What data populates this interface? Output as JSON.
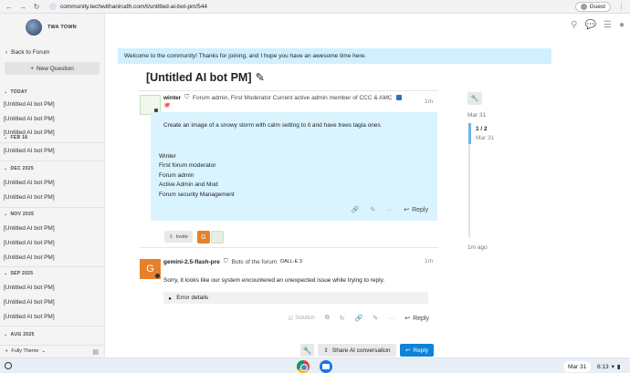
{
  "browser": {
    "url": "community.techwithanirudh.com/t/untitled-ai-bot-pm/544",
    "guest_label": "Guest"
  },
  "site": {
    "name": "TWA TOWN"
  },
  "sidebar": {
    "back_label": "Back to Forum",
    "new_question_label": "New Question",
    "sections": [
      {
        "label": "TODAY",
        "items": [
          "[Untitled AI bot PM]",
          "[Untitled AI bot PM]",
          "[Untitled AI bot PM]"
        ]
      },
      {
        "label": "FEB 18",
        "items": [
          "[Untitled AI bot PM]"
        ]
      },
      {
        "label": "DEC 2025",
        "items": [
          "[Untitled AI bot PM]",
          "[Untitled AI bot PM]"
        ]
      },
      {
        "label": "NOV 2025",
        "items": [
          "[Untitled AI bot PM]",
          "[Untitled AI bot PM]",
          "[Untitled AI bot PM]"
        ]
      },
      {
        "label": "SEP 2025",
        "items": [
          "[Untitled AI bot PM]",
          "[Untitled AI bot PM]",
          "[Untitled AI bot PM]"
        ]
      },
      {
        "label": "AUG 2025",
        "items": []
      }
    ],
    "theme_label": "Fully Theme"
  },
  "banner": "Welcome to the community! Thanks for joining, and I hope you have an awesome time here.",
  "topic": {
    "title": "[Untitled AI bot PM]"
  },
  "posts": [
    {
      "username": "winter",
      "title": "Forum admin, First Moderator Current active admin member of CCC & AMC",
      "emoji": "🐙",
      "time": "1m",
      "question": "Create an image of a snowy storm with calm setting to it and have trees tagia ones",
      "signature": [
        "Winter",
        "First forum moderator",
        "Forum admin",
        "Active Admin and Mod",
        "Forum security Management"
      ],
      "reply_label": "Reply"
    },
    {
      "username": "gemini-2.5-flash-pre",
      "title": "Bots of the forum",
      "tag": "DALL-E 3",
      "time": "1m",
      "message": "Sorry, it looks like our system encountered an unexpected issue while trying to reply.",
      "details_label": "Error details",
      "solution_label": "Solution",
      "reply_label": "Reply"
    }
  ],
  "invite_label": "Invite",
  "participant_avatar_letter": "G",
  "bottom": {
    "share_label": "Share AI conversation",
    "reply_label": "Reply"
  },
  "timeline": {
    "start": "Mar 31",
    "count": "1 / 2",
    "current_date": "Mar 31",
    "end": "1m ago"
  },
  "taskbar": {
    "date": "Mar 31",
    "time": "6:13"
  },
  "colors": {
    "banner": "#d1f0ff",
    "post_body": "#d9f4ff",
    "reply_primary": "#0f82d8",
    "avatar_orange": "#e5812b"
  }
}
